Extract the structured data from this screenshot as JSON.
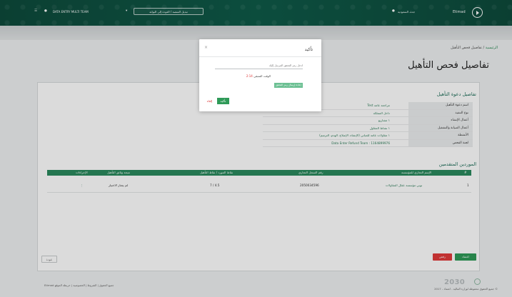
{
  "header": {
    "username": "DATA ENTRY MULTI TEAM",
    "switch_button": "تبديل المنصة / العودة إلى البوابة",
    "location": "جدة، السعودية",
    "brand": "Etimad"
  },
  "breadcrumb": {
    "home": "الرئيسية",
    "separator": "/",
    "current": "تفاصيل فحص التأهيل"
  },
  "page_title": "تفاصيل فحص التأهيل",
  "invitation": {
    "section_title": "تفاصيل دعوة التأهيل",
    "rows": [
      {
        "label": "اسم دعوة التأهيل",
        "value": "مراجعة عامة Test"
      },
      {
        "label": "نوع التنفيذ",
        "value": "داخل المملكة"
      },
      {
        "label": "أعمال الإنشاء",
        "value": "١ مشاريع"
      },
      {
        "label": "أعمال الصيانة والتشغيل",
        "value": "١ نشاط المقاول"
      },
      {
        "label": "الأنشطة",
        "value": "١ مقاولات عامة للمباني (الإنشاء، الإصلاح، الهدم، الترميم)"
      },
      {
        "label": "لجنة الفحص",
        "value": "Data Enter Refund Team : 1164899976"
      }
    ]
  },
  "suppliers": {
    "section_title": "الموردين المتقدمين",
    "columns": [
      "#",
      "الإسم التجاري للمؤسسة",
      "رقم السجل التجاري",
      "نقاط المورد / نقاط التأهيل",
      "نتيجة وثائق التأهيل",
      "الإجراءات"
    ],
    "rows": [
      {
        "num": "1",
        "name": "نوبي مؤسسة عقال المقاولات",
        "cr": "2050034596",
        "score": "7 / 4.5",
        "result": "لم يجتاز الاختيار",
        "action": "⋮"
      }
    ]
  },
  "buttons": {
    "back": "عودة",
    "approve": "اعتماد",
    "reject": "رفض"
  },
  "footer": {
    "left": "Etimad جميع الحقوق  |  الشروط  |  الخصوصية  |  خريطة الموقع",
    "right": "© جميع الحقوق محفوظة لوزارة المالية - اعتماد - 2017",
    "vision": "2030"
  },
  "modal": {
    "title": "تأكيد",
    "close": "×",
    "input_placeholder": "أدخل رمز التحقق المرسل إليك",
    "countdown_label": "الوقت المتبقي",
    "countdown_value": "2:14",
    "resend": "إعادة إرسال رمز التحقق",
    "confirm": "تأكيد",
    "cancel": "إلغاء"
  },
  "colors": {
    "primary": "#2f9a58",
    "header": "#0f5a48",
    "danger": "#e13b3b"
  }
}
